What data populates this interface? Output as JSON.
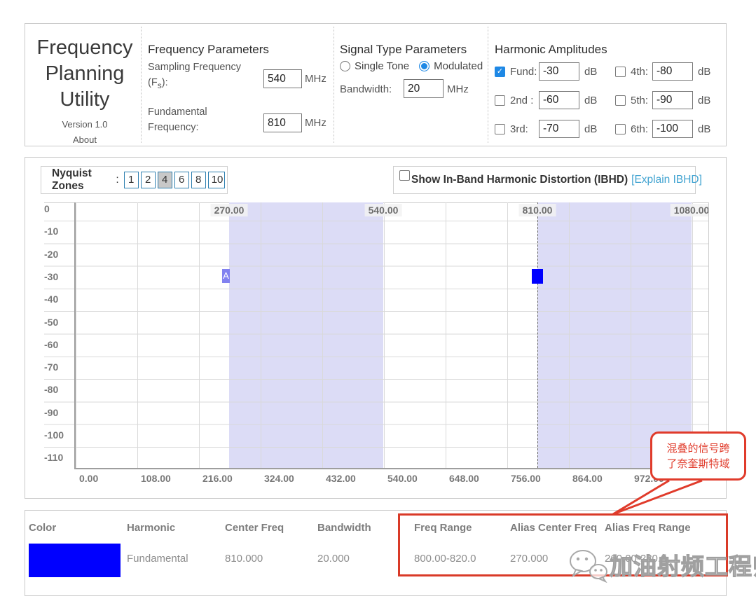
{
  "app": {
    "title_line1": "Frequency",
    "title_line2": "Planning",
    "title_line3": "Utility",
    "version": "Version 1.0",
    "about": "About"
  },
  "fp": {
    "heading": "Frequency Parameters",
    "sampling_line1": "Sampling Frequency",
    "fs_pre": "(F",
    "fs_sub": "s",
    "fs_post": "):",
    "sampling_value": "540",
    "sampling_unit": "MHz",
    "fund_line1": "Fundamental",
    "fund_line2": "Frequency:",
    "fund_value": "810",
    "fund_unit": "MHz"
  },
  "st": {
    "heading": "Signal Type Parameters",
    "option1": "Single Tone",
    "option2": "Modulated",
    "selected": "Modulated",
    "bandwidth_label": "Bandwidth:",
    "bandwidth_value": "20",
    "bandwidth_unit": "MHz"
  },
  "harm": {
    "heading": "Harmonic Amplitudes",
    "items": [
      {
        "label": "Fund:",
        "value": "-30",
        "unit": "dB",
        "checked": true
      },
      {
        "label": "2nd :",
        "value": "-60",
        "unit": "dB",
        "checked": false
      },
      {
        "label": "3rd:",
        "value": "-70",
        "unit": "dB",
        "checked": false
      },
      {
        "label": "4th:",
        "value": "-80",
        "unit": "dB",
        "checked": false
      },
      {
        "label": "5th:",
        "value": "-90",
        "unit": "dB",
        "checked": false
      },
      {
        "label": "6th:",
        "value": "-100",
        "unit": "dB",
        "checked": false
      }
    ]
  },
  "zones": {
    "label": "Nyquist Zones",
    "colon": ":",
    "buttons": [
      "1",
      "2",
      "4",
      "6",
      "8",
      "10"
    ],
    "selected": "4"
  },
  "ibhd": {
    "label": "Show In-Band Harmonic Distortion (IBHD)",
    "link": "[Explain IBHD]",
    "checked": false
  },
  "chart_data": {
    "type": "area",
    "title": "",
    "xlabel": "",
    "ylabel": "",
    "x_range_mhz": [
      0,
      1110
    ],
    "y_range_db": [
      0,
      -120
    ],
    "grid": true,
    "x_ticks": [
      "0.00",
      "108.00",
      "216.00",
      "324.00",
      "432.00",
      "540.00",
      "648.00",
      "756.00",
      "864.00",
      "972.00"
    ],
    "y_ticks": [
      "0",
      "-10",
      "-20",
      "-30",
      "-40",
      "-50",
      "-60",
      "-70",
      "-80",
      "-90",
      "-100",
      "-110"
    ],
    "nyquist_boundaries": [
      "270.00",
      "540.00",
      "810.00",
      "1080.00"
    ],
    "nyquist_boundaries_mhz": [
      270,
      540,
      810,
      1080
    ],
    "shaded_zones_mhz": [
      [
        270,
        540
      ],
      [
        810,
        1080
      ]
    ],
    "fundamental_dashed_line_mhz": 810,
    "signals": [
      {
        "name": "Fundamental",
        "center_freq_mhz": 810,
        "bandwidth_mhz": 20,
        "amplitude_db": -30,
        "color": "#0000ff",
        "marker": ""
      },
      {
        "name": "Alias",
        "center_freq_mhz": 270,
        "bandwidth_mhz": 20,
        "amplitude_db": -30,
        "color": "#8282f0",
        "marker": "A"
      }
    ]
  },
  "callout": {
    "line1": "混叠的信号跨",
    "line2": "了奈奎斯特域",
    "color": "#e03b2b"
  },
  "table": {
    "headers": [
      "Color",
      "Harmonic",
      "Center Freq",
      "Bandwidth",
      "Freq Range",
      "Alias Center Freq",
      "Alias Freq Range"
    ],
    "rows": [
      {
        "color_hex": "#0000ff",
        "cells": [
          "Fundamental",
          "810.000",
          "20.000",
          "800.00-820.0",
          "270.000",
          "260.00-280.0"
        ]
      }
    ]
  },
  "watermark": {
    "text": "加油射频工程师"
  },
  "icons": {
    "check": "✓"
  },
  "colors": {
    "accent_blue": "#1e88e5",
    "link_blue": "#41a3d1",
    "zone_shade": "#dcdcf6",
    "fundamental_blue": "#0000ff",
    "alias_purple": "#8282f0",
    "annotation_red": "#e03b2b",
    "panel_border": "#c9c9c9"
  }
}
